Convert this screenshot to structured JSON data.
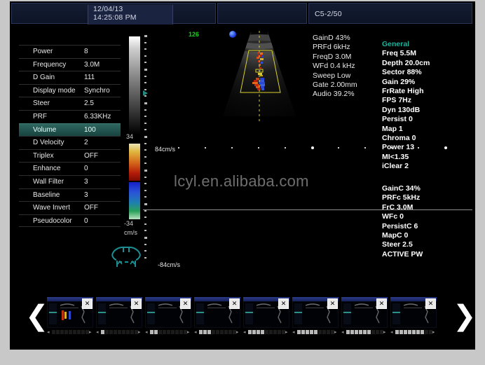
{
  "header": {
    "date": "12/04/13",
    "time": "14:25:08 PM",
    "probe": "C5-2/50"
  },
  "parameters": {
    "rows": [
      {
        "key": "Power",
        "value": "8",
        "selected": false
      },
      {
        "key": "Frequency",
        "value": "3.0M",
        "selected": false
      },
      {
        "key": "D Gain",
        "value": "111",
        "selected": false
      },
      {
        "key": "Display mode",
        "value": "Synchro",
        "selected": false
      },
      {
        "key": "Steer",
        "value": "2.5",
        "selected": false
      },
      {
        "key": "PRF",
        "value": "6.33KHz",
        "selected": false
      },
      {
        "key": "Volume",
        "value": "100",
        "selected": true
      },
      {
        "key": "D Velocity",
        "value": "2",
        "selected": false
      },
      {
        "key": "Triplex",
        "value": "OFF",
        "selected": false
      },
      {
        "key": "Enhance",
        "value": "0",
        "selected": false
      },
      {
        "key": "Wall Filter",
        "value": "3",
        "selected": false
      },
      {
        "key": "Baseline",
        "value": "3",
        "selected": false
      },
      {
        "key": "Wave Invert",
        "value": "OFF",
        "selected": false
      },
      {
        "key": "Pseudocolor",
        "value": "0",
        "selected": false
      }
    ]
  },
  "scales": {
    "gray_max": "34",
    "color_min": "-34",
    "color_unit": "cm/s",
    "doppler_top": "84cm/s",
    "doppler_bottom": "-84cm/s",
    "frame_count": "126"
  },
  "doppler_measurements": {
    "lines": [
      "GainD 43%",
      "PRFd 6kHz",
      "FreqD 3.0M",
      "WFd 0.4 kHz",
      "Sweep Low",
      "Gate 2.00mm",
      "Audio 39.2%"
    ]
  },
  "general_panel": {
    "title": "General",
    "lines": [
      "Freq 5.5M",
      "Depth 20.0cm",
      "Sector 88%",
      "Gain 29%",
      "FrRate High",
      "FPS 7Hz",
      "Dyn 130dB",
      "Persist 0",
      "Map 1",
      "Chroma 0",
      "Power 13",
      "MI<1.35",
      "iClear 2"
    ]
  },
  "color_panel": {
    "lines": [
      "GainC 34%",
      "PRFc 5kHz",
      "FrC 3.0M",
      "WFc 0",
      "PersistC 6",
      "MapC 0",
      "Steer 2.5",
      "ACTIVE PW"
    ]
  },
  "watermark": "lcyl.en.alibaba.com",
  "thumbnail_strip": {
    "prev_label": "❮",
    "next_label": "❯",
    "close_label": "✕",
    "count": 8
  },
  "colors": {
    "accent_teal": "#1fb39c",
    "header_bg": "#141c32",
    "screen_bg": "#000000",
    "page_bg": "#c8c8c8",
    "roi_yellow": "#d8d02a",
    "fps_green": "#18d018"
  }
}
